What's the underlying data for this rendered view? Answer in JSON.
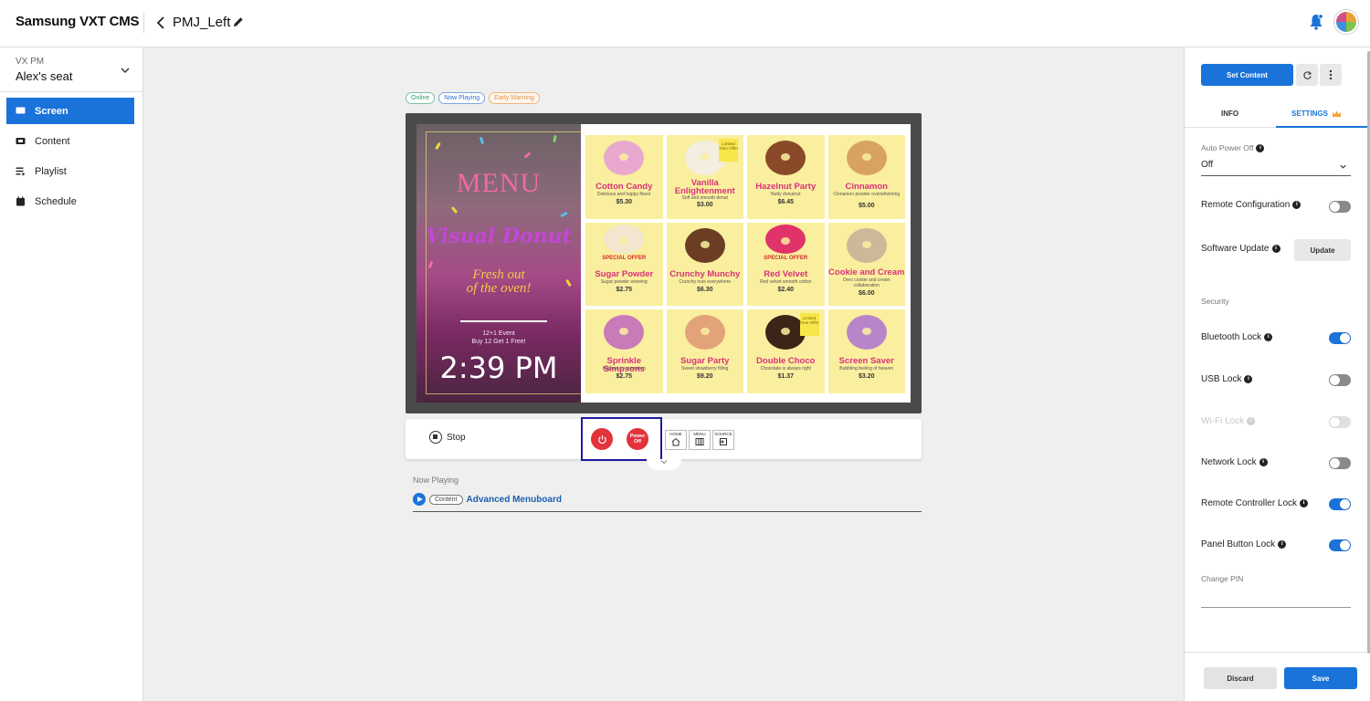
{
  "header": {
    "brand": "Samsung VXT CMS",
    "page_title": "PMJ_Left"
  },
  "sidebar": {
    "workspace_label": "VX PM",
    "workspace_name": "Alex's seat",
    "items": [
      {
        "label": "Screen",
        "icon": "monitor-icon",
        "active": true
      },
      {
        "label": "Content",
        "icon": "content-icon",
        "active": false
      },
      {
        "label": "Playlist",
        "icon": "playlist-icon",
        "active": false
      },
      {
        "label": "Schedule",
        "icon": "calendar-icon",
        "active": false
      }
    ]
  },
  "status_badges": [
    "Online",
    "Now Playing",
    "Early Warning"
  ],
  "preview": {
    "menu_title": "MENU",
    "brand_name": "Visual Donut",
    "tagline_line1": "Fresh out",
    "tagline_line2": "of the oven!",
    "event_line1": "12+1 Event",
    "event_line2": "Buy 12 Get 1 Free!",
    "time": "2:39 PM",
    "items": [
      {
        "name": "Cotton Candy",
        "desc": "Delicious and happy flavor",
        "price": "$5.30",
        "color": "#e9a9cf",
        "special": "",
        "limited": false
      },
      {
        "name": "Vanilla Enlightenment",
        "desc": "Soft and smooth donut",
        "price": "$3.00",
        "color": "#f3eee0",
        "special": "",
        "limited": true
      },
      {
        "name": "Hazelnut Party",
        "desc": "Nutty donutnut",
        "price": "$6.45",
        "color": "#8a4a2a",
        "special": "",
        "limited": false
      },
      {
        "name": "Cinnamon",
        "desc": "Cinnamon powder overwhelming",
        "price": "$5.00",
        "color": "#d8a361",
        "special": "",
        "limited": false
      },
      {
        "name": "Sugar Powder",
        "desc": "Sugar powder snowing",
        "price": "$2.75",
        "color": "#f2e6cf",
        "special": "SPECIAL OFFER",
        "limited": false
      },
      {
        "name": "Crunchy Munchy",
        "desc": "Crunchy nuts everywhere",
        "price": "$6.30",
        "color": "#6b3e24",
        "special": "",
        "limited": false
      },
      {
        "name": "Red Velvet",
        "desc": "Red velvet smooth cotton",
        "price": "$2.40",
        "color": "#e0336a",
        "special": "SPECIAL OFFER",
        "limited": false
      },
      {
        "name": "Cookie and Cream",
        "desc": "Oreo cookie and cream collaboration",
        "price": "$6.00",
        "color": "#cdb89a",
        "special": "",
        "limited": false
      },
      {
        "name": "Sprinkle Simpsons",
        "desc": "Inspired by animation",
        "price": "$2.75",
        "color": "#c97ab8",
        "special": "",
        "limited": false
      },
      {
        "name": "Sugar Party",
        "desc": "Sweet strawberry filling",
        "price": "$9.20",
        "color": "#e3a37a",
        "special": "",
        "limited": false
      },
      {
        "name": "Double Choco",
        "desc": "Chocolate is always right",
        "price": "$1.37",
        "color": "#3b2418",
        "special": "",
        "limited": true
      },
      {
        "name": "Screen Saver",
        "desc": "Bubbling feeling of heaven",
        "price": "$3.20",
        "color": "#b886c8",
        "special": "",
        "limited": false
      }
    ],
    "limited_text": "Limited Time Offer"
  },
  "controls": {
    "stop_label": "Stop",
    "power_off_label": "Power Off",
    "keys": [
      "HOME",
      "MENU",
      "SOURCE"
    ]
  },
  "now_playing": {
    "label": "Now Playing",
    "chip": "Content",
    "title": "Advanced Menuboard"
  },
  "panel": {
    "set_content": "Set Content",
    "tab_info": "INFO",
    "tab_settings": "SETTINGS",
    "auto_power_off_label": "Auto Power Off",
    "auto_power_off_value": "Off",
    "remote_configuration": "Remote Configuration",
    "software_update": "Software Update",
    "update_button": "Update",
    "security_heading": "Security",
    "bluetooth_lock": "Bluetooth Lock",
    "usb_lock": "USB Lock",
    "wifi_lock": "Wi-Fi Lock",
    "network_lock": "Network Lock",
    "remote_controller_lock": "Remote Controller Lock",
    "panel_button_lock": "Panel Button Lock",
    "change_pin": "Change PIN",
    "discard": "Discard",
    "save": "Save",
    "toggles": {
      "remote_configuration": false,
      "bluetooth_lock": true,
      "usb_lock": false,
      "wifi_lock": false,
      "network_lock": false,
      "remote_controller_lock": true,
      "panel_button_lock": true
    }
  },
  "colors": {
    "accent": "#1a73d9",
    "power_red": "#e2333a",
    "online_green": "#2e9e68",
    "warning_orange": "#e29246"
  }
}
